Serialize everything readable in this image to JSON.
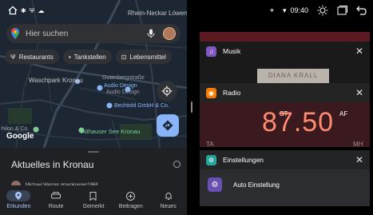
{
  "maps": {
    "search_placeholder": "Hier suchen",
    "chips": [
      {
        "icon": "fork-knife-icon",
        "label": "Restaurants"
      },
      {
        "icon": "gas-station-icon",
        "label": "Tankstellen"
      },
      {
        "icon": "cart-icon",
        "label": "Lebensmittel"
      }
    ],
    "map_labels": {
      "rhein_neckar": "Rhein-Neckar Löwen",
      "gutenberg": "Gutenbergstraße",
      "waschpark": "Waschpark Kronau",
      "audio_design": "Audio Design",
      "audio_design2": "Audio Design",
      "bechtold": "Bechtold GmbH & Co.",
      "althauser": "Althauser See Kronau",
      "hilton": "hilon & Co."
    },
    "logo": "Google",
    "sheet_title": "Aktuelles in Kronau",
    "peek_text": "Michael Werner groenkoeper1968",
    "nav": [
      {
        "icon": "location-pin-icon",
        "label": "Erkunden",
        "active": true
      },
      {
        "icon": "car-icon",
        "label": "Route",
        "active": false
      },
      {
        "icon": "bookmark-icon",
        "label": "Gemerkt",
        "active": false
      },
      {
        "icon": "plus-circle-icon",
        "label": "Beitragen",
        "active": false
      },
      {
        "icon": "bell-icon",
        "label": "Neues",
        "active": false
      }
    ]
  },
  "status": {
    "time": "09:40"
  },
  "recents": {
    "musik": {
      "title": "Musik",
      "art_text": "DIANA KRALL"
    },
    "radio": {
      "title": "Radio",
      "st": "ST",
      "af": "AF",
      "tp": "TA",
      "frequency": "87.50",
      "unit": "MH"
    },
    "einstellungen": {
      "title": "Einstellungen",
      "item": "Auto Einstellung"
    }
  },
  "colors": {
    "map_bg": "#1d2733",
    "accent_blue": "#8ab4f8",
    "radio_freq": "#ff8a6e",
    "musik_icon": "#7e57c2",
    "radio_icon": "#f57c00",
    "einst_icon": "#26a69a"
  }
}
